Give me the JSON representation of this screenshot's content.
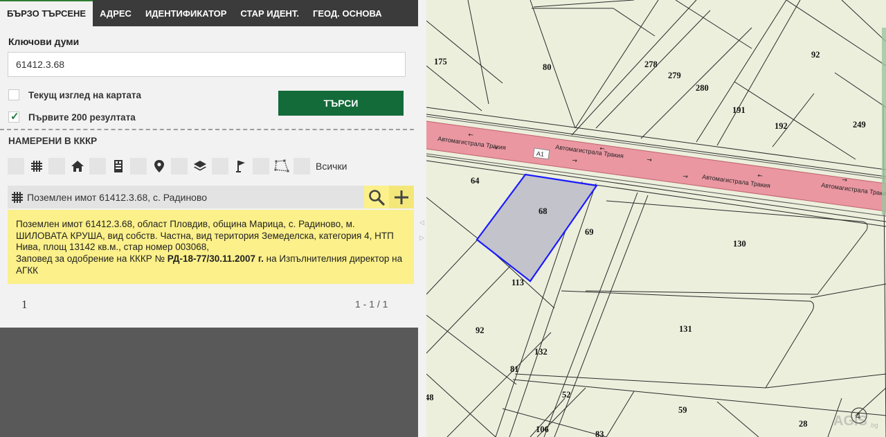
{
  "tabs": [
    {
      "label": "БЪРЗО ТЪРСЕНЕ",
      "active": true
    },
    {
      "label": "АДРЕС"
    },
    {
      "label": "ИДЕНТИФИКАТОР"
    },
    {
      "label": "СТАР ИДЕНТ."
    },
    {
      "label": "ГЕОД. ОСНОВА"
    }
  ],
  "search": {
    "keywords_label": "Ключови думи",
    "keywords_value": "61412.3.68",
    "current_view_label": "Текущ изглед на картата",
    "current_view_checked": false,
    "first200_label": "Първите 200 резултата",
    "first200_checked": true,
    "button_label": "ТЪРСИ"
  },
  "results": {
    "title": "НАМЕРЕНИ В КККР",
    "filter_icons": [
      "grid-icon",
      "home-icon",
      "building-icon",
      "location-pin-icon",
      "layers-icon",
      "flag-icon",
      "polygon-icon"
    ],
    "all_label": "Всички",
    "item_title": "Поземлен имот 61412.3.68, с. Радиново",
    "info_text_1": "Поземлен имот 61412.3.68, област Пловдив, община Марица, с. Радиново, м. ШИЛОВАТА КРУША, вид собств. Частна, вид територия Земеделска, категория 4, НТП Нива, площ 13142 кв.м., стар номер 003068,",
    "info_text_2": "Заповед за одобрение на КККР №",
    "info_text_bold": "РД-18-77/30.11.2007 г.",
    "info_text_3": "на Изпълнителния директор на АГКК",
    "page_number": "1",
    "page_range": "1 - 1 / 1"
  },
  "map": {
    "road_name": "Автомагистрала Тракия",
    "road_shield": "А1",
    "compass_label": "4",
    "watermark": "AGIS",
    "watermark_sub": ".bg",
    "plot_labels": [
      "175",
      "80",
      "278",
      "279",
      "280",
      "92",
      "191",
      "192",
      "249",
      "64",
      "68",
      "69",
      "130",
      "113",
      "131",
      "92",
      "132",
      "81",
      "52",
      "59",
      "28",
      "106",
      "83",
      "48"
    ],
    "highlight_color": "#c3c3cc",
    "highlight_stroke": "#1a1aff",
    "road_color": "#ea97a2",
    "background_color": "#ecefdc"
  },
  "colors": {
    "accent_green": "#136b3a",
    "info_yellow": "#fbf08a",
    "tab_bar": "#3b3b3b"
  }
}
